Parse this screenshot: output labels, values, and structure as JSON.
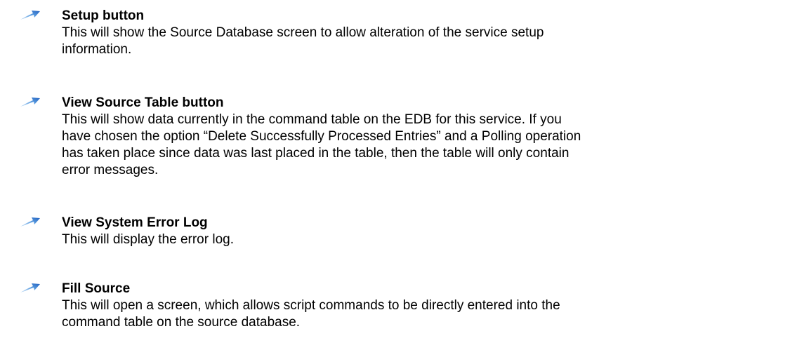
{
  "entries": [
    {
      "title": "Setup button",
      "lines": [
        "This will show the Source Database screen to allow alteration of the service setup",
        "information."
      ]
    },
    {
      "title": "View Source Table button",
      "lines": [
        "This will show data currently in the command table on the EDB for this service. If you",
        "have chosen the option “Delete Successfully Processed Entries” and a Polling operation",
        "has taken place since data was last placed in the table, then the table will only contain",
        "error messages."
      ]
    },
    {
      "title": "View System Error Log",
      "lines": [
        "This will display the error log."
      ]
    },
    {
      "title": "Fill Source",
      "lines": [
        "This will open a screen, which allows script commands to be directly entered into the",
        "command table on the source database."
      ]
    }
  ],
  "bullet_icon": "blue-arrow-bullet-icon",
  "colors": {
    "bullet_dark": "#1f5fbf",
    "bullet_light": "#9cc8f0",
    "text": "#000000"
  }
}
